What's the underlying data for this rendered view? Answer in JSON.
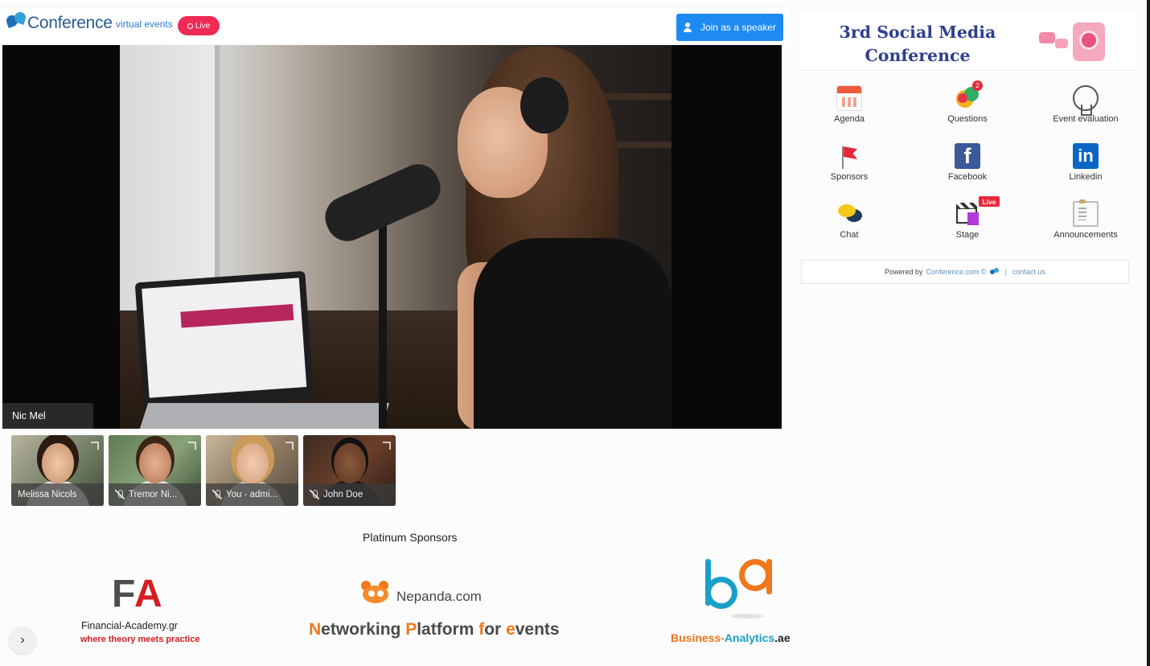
{
  "header": {
    "brand": "Conference",
    "brand_sub": "virtual events",
    "live_label": "Live",
    "speaker_button": "Join as a speaker"
  },
  "stage": {
    "speaker_name": "Nic Mel"
  },
  "participants": [
    {
      "name": "Melissa Nicols",
      "muted": false
    },
    {
      "name": "Tremor Ni...",
      "muted": true
    },
    {
      "name": "You - admi...",
      "muted": true
    },
    {
      "name": "John Doe",
      "muted": true
    }
  ],
  "sponsors": {
    "title": "Platinum Sponsors",
    "financial_academy": {
      "mark_f": "F",
      "mark_a": "A",
      "name": "Financial-Academy.gr",
      "tagline": "where theory meets practice"
    },
    "nepanda": {
      "name": "Nepanda.com",
      "tagline_parts": [
        "N",
        "etworking ",
        "P",
        "latform ",
        "f",
        "or ",
        "e",
        "vents"
      ]
    },
    "business_analytics": {
      "name_1": "Business-",
      "name_2": "Analytics",
      "name_3": ".ae"
    }
  },
  "side_toggle": "›",
  "panel": {
    "title": "3rd Social Media Conference",
    "tiles": [
      {
        "label": "Agenda",
        "icon": "calendar-icon"
      },
      {
        "label": "Questions",
        "icon": "questions-icon",
        "badge": "2"
      },
      {
        "label": "Event evaluation",
        "icon": "evaluation-icon"
      },
      {
        "label": "Sponsors",
        "icon": "flag-icon"
      },
      {
        "label": "Facebook",
        "icon": "facebook-icon",
        "glyph": "f"
      },
      {
        "label": "Linkedin",
        "icon": "linkedin-icon",
        "glyph": "in"
      },
      {
        "label": "Chat",
        "icon": "chat-icon"
      },
      {
        "label": "Stage",
        "icon": "stage-icon",
        "badge": "Live"
      },
      {
        "label": "Announcements",
        "icon": "announcements-icon"
      }
    ],
    "powered_by": "Powered by",
    "powered_link": "Conference.com ©",
    "contact": "contact us"
  },
  "colors": {
    "accent_blue": "#1e8bf2",
    "live_red": "#ef2a55",
    "title_navy": "#2e3f8f"
  }
}
